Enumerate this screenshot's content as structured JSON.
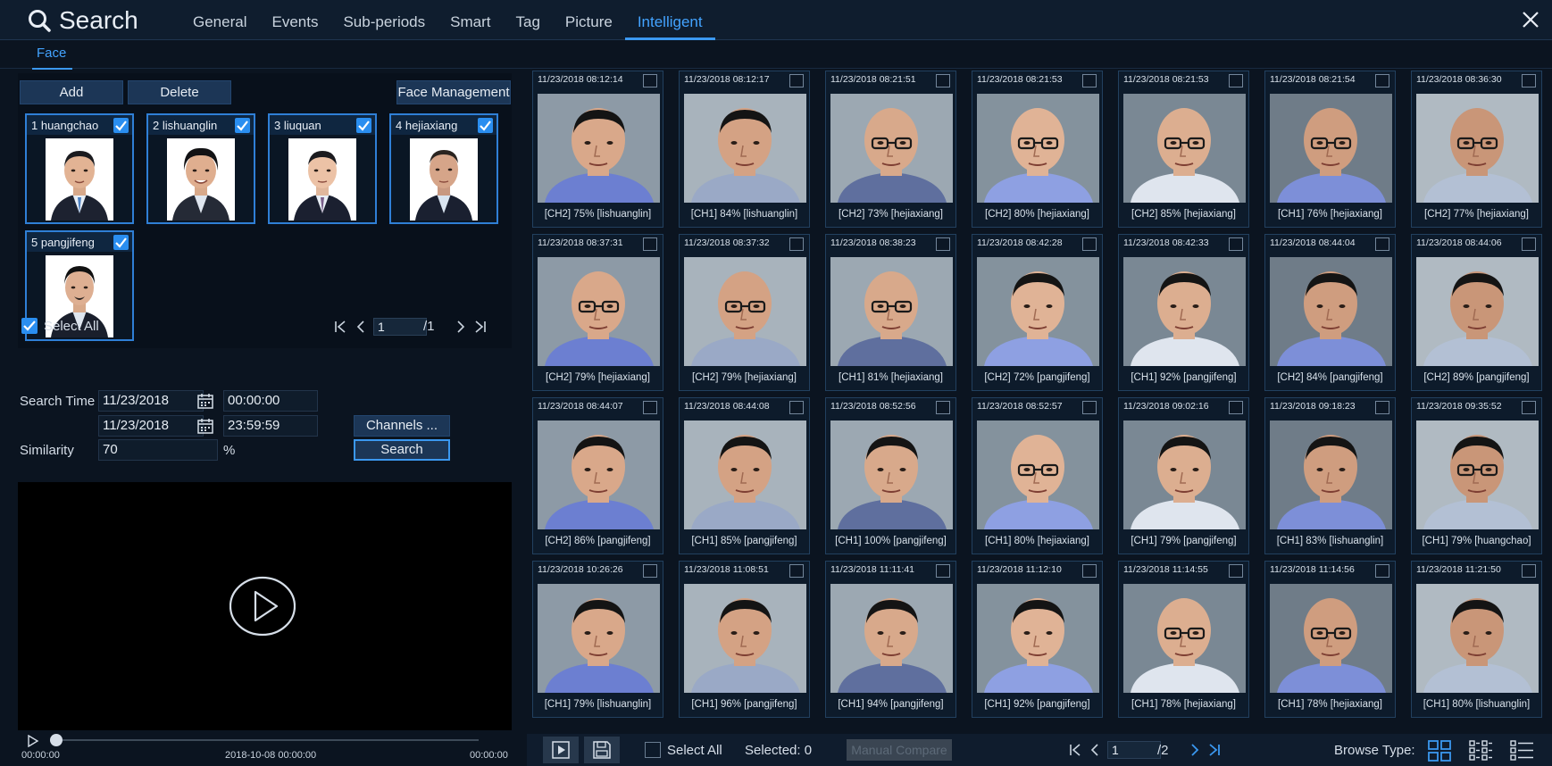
{
  "header": {
    "title": "Search",
    "tabs": [
      {
        "label": "General",
        "active": false
      },
      {
        "label": "Events",
        "active": false
      },
      {
        "label": "Sub-periods",
        "active": false
      },
      {
        "label": "Smart",
        "active": false
      },
      {
        "label": "Tag",
        "active": false
      },
      {
        "label": "Picture",
        "active": false
      },
      {
        "label": "Intelligent",
        "active": true
      }
    ],
    "subtab": "Face",
    "accent_color": "#3b98f0"
  },
  "left": {
    "add_label": "Add",
    "delete_label": "Delete",
    "face_management_label": "Face Management",
    "faces": [
      {
        "label": "1  huangchao",
        "checked": true
      },
      {
        "label": "2  lishuanglin",
        "checked": true
      },
      {
        "label": "3  liuquan",
        "checked": true
      },
      {
        "label": "4  hejiaxiang",
        "checked": true
      },
      {
        "label": "5  pangjifeng",
        "checked": true
      }
    ],
    "select_all_label": "Select All",
    "page_current": "1",
    "page_total": "/1",
    "search_time_label": "Search Time",
    "start_date": "11/23/2018",
    "start_time": "00:00:00",
    "end_date": "11/23/2018",
    "end_time": "23:59:59",
    "similarity_label": "Similarity",
    "similarity_value": "70",
    "percent_label": "%",
    "channels_label": "Channels ...",
    "search_label": "Search"
  },
  "player": {
    "time_start": "00:00:00",
    "time_mid": "2018-10-08 00:00:00",
    "time_end": "00:00:00"
  },
  "results": [
    {
      "ts": "11/23/2018 08:12:14",
      "cap": "[CH2] 75% [lishuanglin]"
    },
    {
      "ts": "11/23/2018 08:12:17",
      "cap": "[CH1] 84% [lishuanglin]"
    },
    {
      "ts": "11/23/2018 08:21:51",
      "cap": "[CH2] 73% [hejiaxiang]"
    },
    {
      "ts": "11/23/2018 08:21:53",
      "cap": "[CH2] 80% [hejiaxiang]"
    },
    {
      "ts": "11/23/2018 08:21:53",
      "cap": "[CH2] 85% [hejiaxiang]"
    },
    {
      "ts": "11/23/2018 08:21:54",
      "cap": "[CH1] 76% [hejiaxiang]"
    },
    {
      "ts": "11/23/2018 08:36:30",
      "cap": "[CH2] 77% [hejiaxiang]"
    },
    {
      "ts": "11/23/2018 08:37:31",
      "cap": "[CH2] 79% [hejiaxiang]"
    },
    {
      "ts": "11/23/2018 08:37:32",
      "cap": "[CH2] 79% [hejiaxiang]"
    },
    {
      "ts": "11/23/2018 08:38:23",
      "cap": "[CH1] 81% [hejiaxiang]"
    },
    {
      "ts": "11/23/2018 08:42:28",
      "cap": "[CH2] 72% [pangjifeng]"
    },
    {
      "ts": "11/23/2018 08:42:33",
      "cap": "[CH1] 92% [pangjifeng]"
    },
    {
      "ts": "11/23/2018 08:44:04",
      "cap": "[CH2] 84% [pangjifeng]"
    },
    {
      "ts": "11/23/2018 08:44:06",
      "cap": "[CH2] 89% [pangjifeng]"
    },
    {
      "ts": "11/23/2018 08:44:07",
      "cap": "[CH2] 86% [pangjifeng]"
    },
    {
      "ts": "11/23/2018 08:44:08",
      "cap": "[CH1] 85% [pangjifeng]"
    },
    {
      "ts": "11/23/2018 08:52:56",
      "cap": "[CH1] 100% [pangjifeng]"
    },
    {
      "ts": "11/23/2018 08:52:57",
      "cap": "[CH1] 80% [hejiaxiang]"
    },
    {
      "ts": "11/23/2018 09:02:16",
      "cap": "[CH1] 79% [pangjifeng]"
    },
    {
      "ts": "11/23/2018 09:18:23",
      "cap": "[CH1] 83% [lishuanglin]"
    },
    {
      "ts": "11/23/2018 09:35:52",
      "cap": "[CH1] 79% [huangchao]"
    },
    {
      "ts": "11/23/2018 10:26:26",
      "cap": "[CH1] 79% [lishuanglin]"
    },
    {
      "ts": "11/23/2018 11:08:51",
      "cap": "[CH1] 96% [pangjifeng]"
    },
    {
      "ts": "11/23/2018 11:11:41",
      "cap": "[CH1] 94% [pangjifeng]"
    },
    {
      "ts": "11/23/2018 11:12:10",
      "cap": "[CH1] 92% [pangjifeng]"
    },
    {
      "ts": "11/23/2018 11:14:55",
      "cap": "[CH1] 78% [hejiaxiang]"
    },
    {
      "ts": "11/23/2018 11:14:56",
      "cap": "[CH1] 78% [hejiaxiang]"
    },
    {
      "ts": "11/23/2018 11:21:50",
      "cap": "[CH1] 80% [lishuanglin]"
    }
  ],
  "bottom": {
    "select_all_label": "Select All",
    "selected_label": "Selected: 0",
    "manual_compare_label": "Manual Compare",
    "page_current": "1",
    "page_total": "/2",
    "browse_type_label": "Browse Type:"
  }
}
